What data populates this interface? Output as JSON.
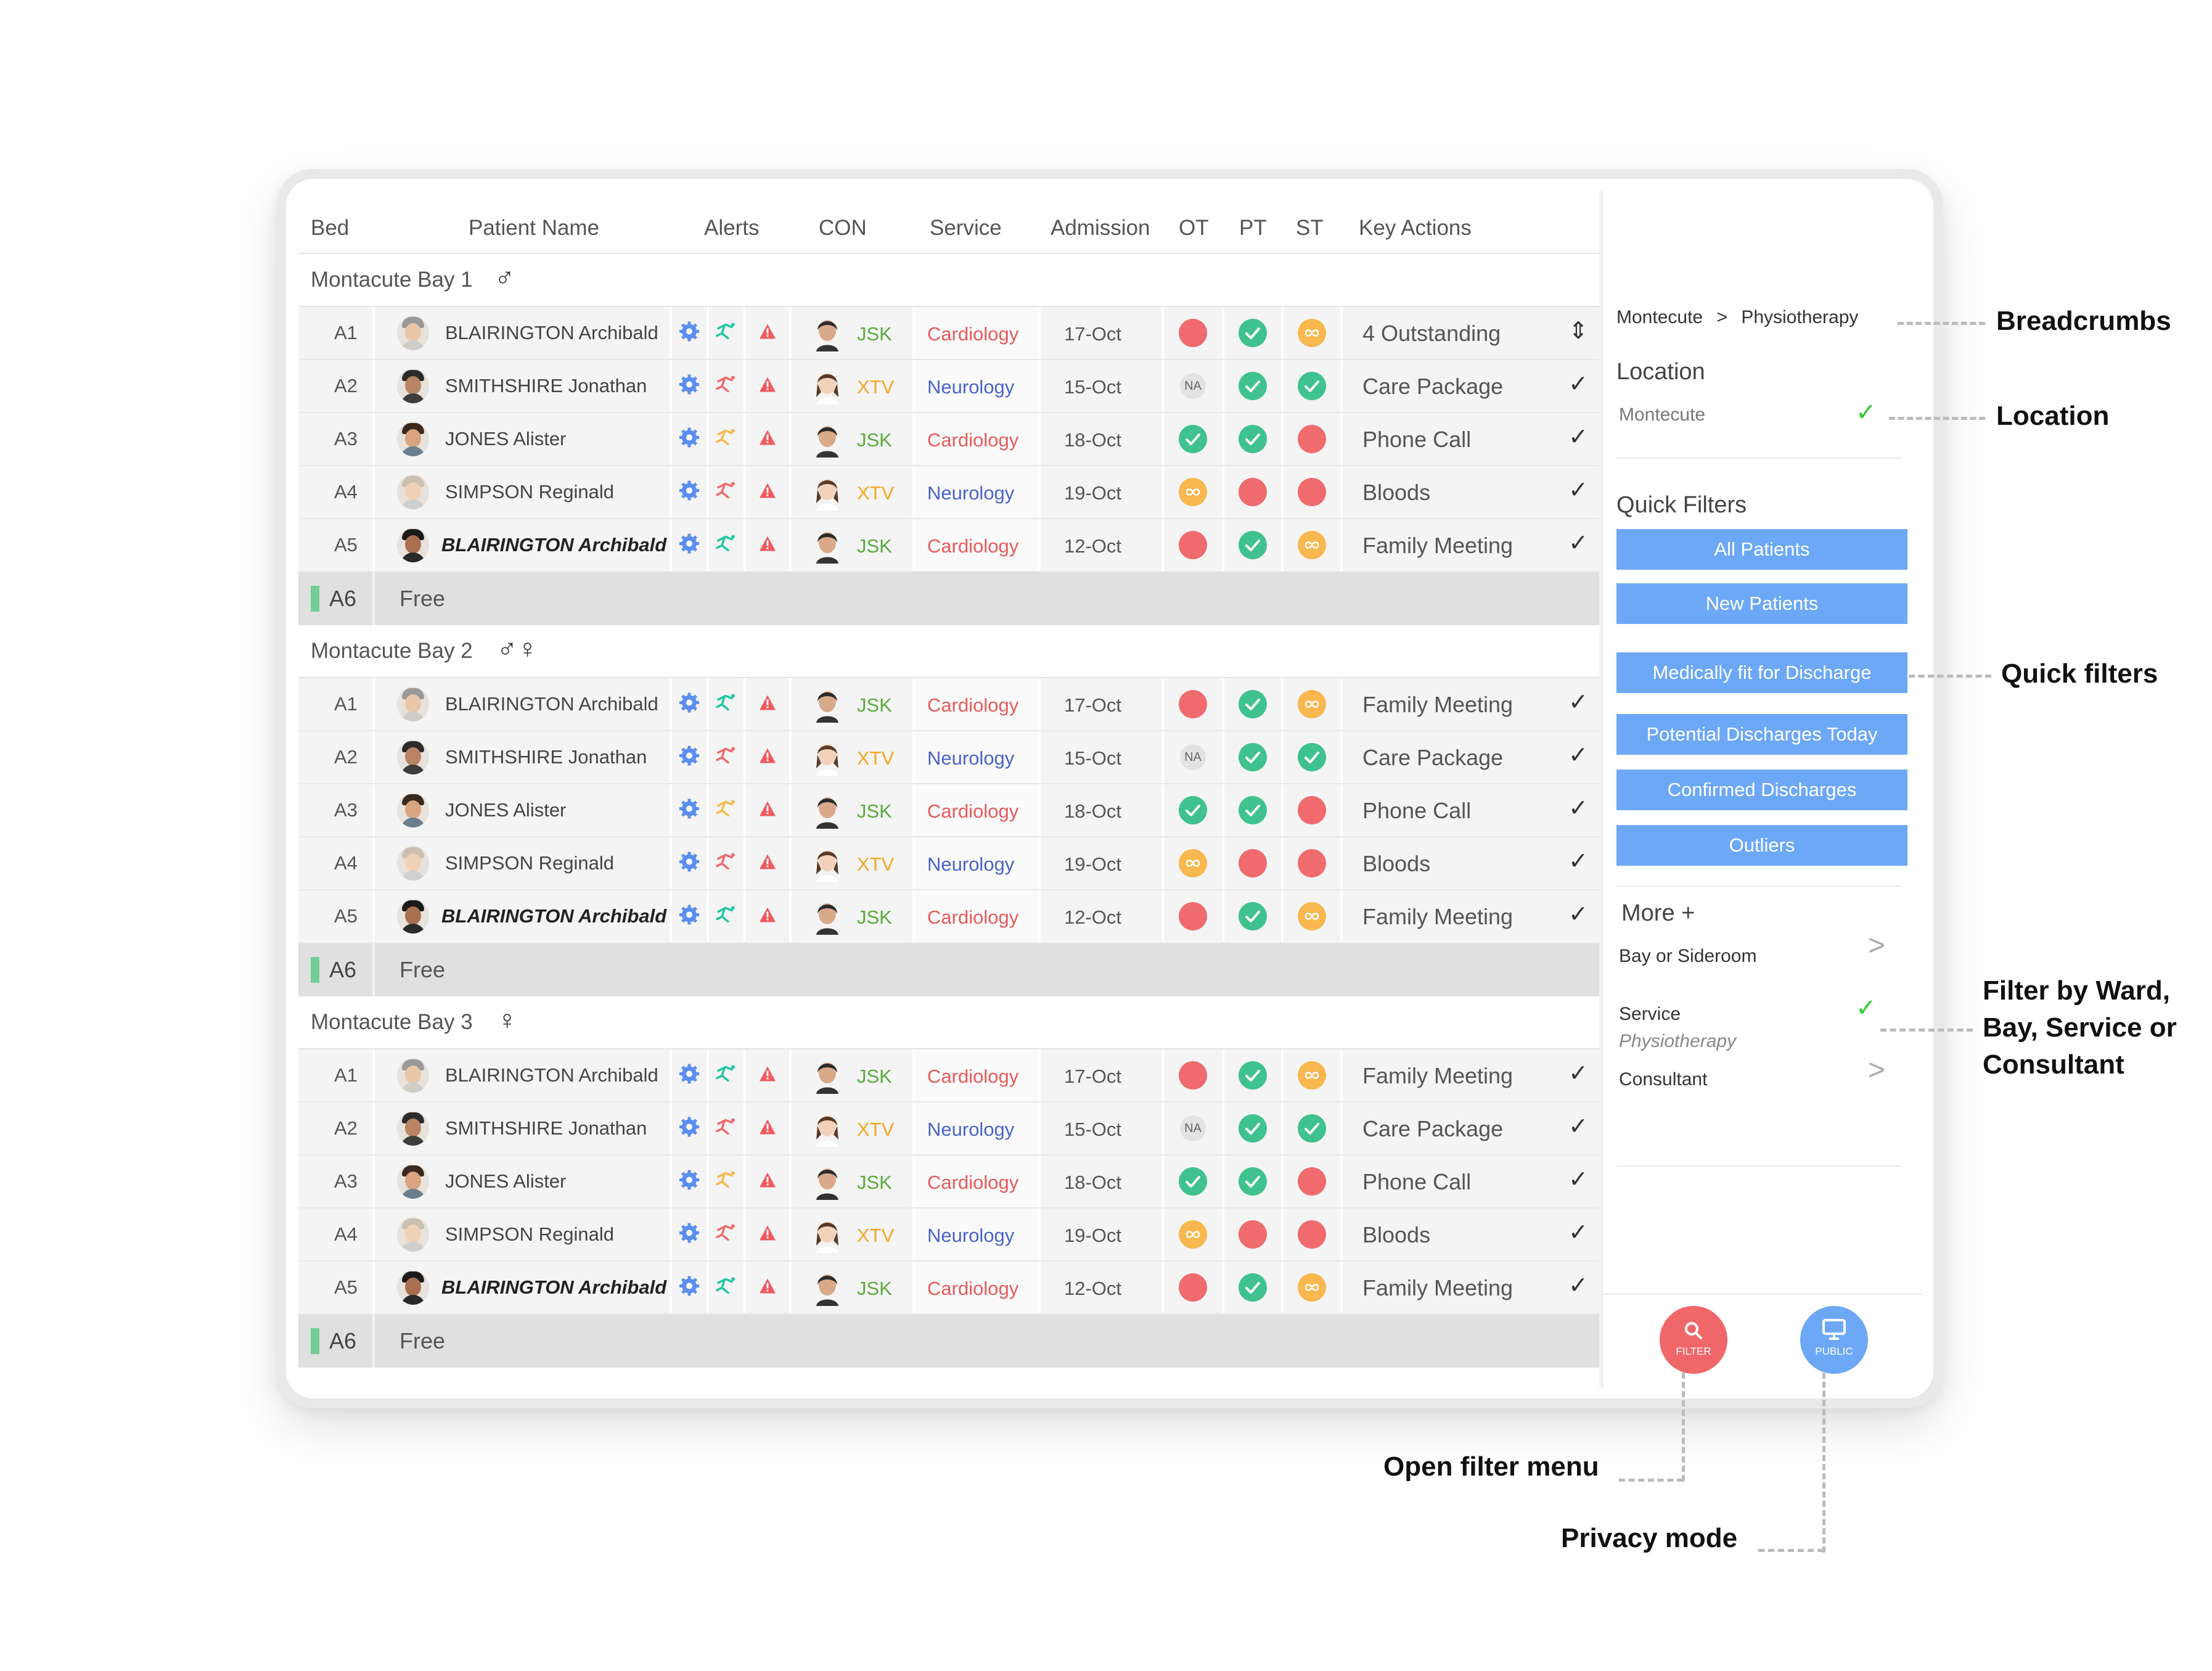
{
  "columns": [
    "Bed",
    "Patient Name",
    "Alerts",
    "CON",
    "Service",
    "Admission",
    "OT",
    "PT",
    "ST",
    "Key Actions"
  ],
  "bays": [
    {
      "name": "Montacute Bay 1",
      "sex_icon": "male-icon",
      "sex_symbol": "♂",
      "rows": [
        {
          "bed": "A1",
          "name": "BLAIRINGTON Archibald",
          "con": "JSK",
          "service": "Cardiology",
          "admission": "17-Oct",
          "ot": "red",
          "pt": "green",
          "st": "orange",
          "action": "4 Outstanding",
          "mark": "⇕"
        },
        {
          "bed": "A2",
          "name": "SMITHSHIRE Jonathan",
          "con": "XTV",
          "service": "Neurology",
          "admission": "15-Oct",
          "ot": "na",
          "pt": "green",
          "st": "green",
          "action": "Care Package",
          "mark": "✓"
        },
        {
          "bed": "A3",
          "name": "JONES Alister",
          "con": "JSK",
          "service": "Cardiology",
          "admission": "18-Oct",
          "ot": "green",
          "pt": "green",
          "st": "red",
          "action": "Phone Call",
          "mark": "✓"
        },
        {
          "bed": "A4",
          "name": "SIMPSON Reginald",
          "con": "XTV",
          "service": "Neurology",
          "admission": "19-Oct",
          "ot": "orange",
          "pt": "red",
          "st": "red",
          "action": "Bloods",
          "mark": "✓"
        },
        {
          "bed": "A5",
          "name": "BLAIRINGTON Archibald",
          "con": "JSK",
          "service": "Cardiology",
          "admission": "12-Oct",
          "ot": "red",
          "pt": "green",
          "st": "orange",
          "action": "Family Meeting",
          "mark": "✓"
        }
      ],
      "free": {
        "bed": "A6",
        "label": "Free"
      }
    },
    {
      "name": "Montacute Bay 2",
      "sex_icon": "mixed-sex-icon",
      "sex_symbol": "♂♀",
      "rows": [
        {
          "bed": "A1",
          "name": "BLAIRINGTON Archibald",
          "con": "JSK",
          "service": "Cardiology",
          "admission": "17-Oct",
          "ot": "red",
          "pt": "green",
          "st": "orange",
          "action": "Family Meeting",
          "mark": "✓"
        },
        {
          "bed": "A2",
          "name": "SMITHSHIRE Jonathan",
          "con": "XTV",
          "service": "Neurology",
          "admission": "15-Oct",
          "ot": "na",
          "pt": "green",
          "st": "green",
          "action": "Care Package",
          "mark": "✓"
        },
        {
          "bed": "A3",
          "name": "JONES Alister",
          "con": "JSK",
          "service": "Cardiology",
          "admission": "18-Oct",
          "ot": "green",
          "pt": "green",
          "st": "red",
          "action": "Phone Call",
          "mark": "✓"
        },
        {
          "bed": "A4",
          "name": "SIMPSON Reginald",
          "con": "XTV",
          "service": "Neurology",
          "admission": "19-Oct",
          "ot": "orange",
          "pt": "red",
          "st": "red",
          "action": "Bloods",
          "mark": "✓"
        },
        {
          "bed": "A5",
          "name": "BLAIRINGTON Archibald",
          "con": "JSK",
          "service": "Cardiology",
          "admission": "12-Oct",
          "ot": "red",
          "pt": "green",
          "st": "orange",
          "action": "Family Meeting",
          "mark": "✓"
        }
      ],
      "free": {
        "bed": "A6",
        "label": "Free"
      }
    },
    {
      "name": "Montacute Bay 3",
      "sex_icon": "female-icon",
      "sex_symbol": "♀",
      "rows": [
        {
          "bed": "A1",
          "name": "BLAIRINGTON Archibald",
          "con": "JSK",
          "service": "Cardiology",
          "admission": "17-Oct",
          "ot": "red",
          "pt": "green",
          "st": "orange",
          "action": "Family Meeting",
          "mark": "✓"
        },
        {
          "bed": "A2",
          "name": "SMITHSHIRE Jonathan",
          "con": "XTV",
          "service": "Neurology",
          "admission": "15-Oct",
          "ot": "na",
          "pt": "green",
          "st": "green",
          "action": "Care Package",
          "mark": "✓"
        },
        {
          "bed": "A3",
          "name": "JONES Alister",
          "con": "JSK",
          "service": "Cardiology",
          "admission": "18-Oct",
          "ot": "green",
          "pt": "green",
          "st": "red",
          "action": "Phone Call",
          "mark": "✓"
        },
        {
          "bed": "A4",
          "name": "SIMPSON Reginald",
          "con": "XTV",
          "service": "Neurology",
          "admission": "19-Oct",
          "ot": "orange",
          "pt": "red",
          "st": "red",
          "action": "Bloods",
          "mark": "✓"
        },
        {
          "bed": "A5",
          "name": "BLAIRINGTON Archibald",
          "con": "JSK",
          "service": "Cardiology",
          "admission": "12-Oct",
          "ot": "red",
          "pt": "green",
          "st": "orange",
          "action": "Family Meeting",
          "mark": "✓"
        }
      ],
      "free": {
        "bed": "A6",
        "label": "Free"
      }
    }
  ],
  "na_label": "NA",
  "sidebar": {
    "breadcrumb": {
      "first": "Montecute",
      "sep": ">",
      "second": "Physiotherapy"
    },
    "location_heading": "Location",
    "location_value": "Montecute",
    "quick_filters_heading": "Quick Filters",
    "quick_filters": [
      "All Patients",
      "New Patients",
      "Medically fit for Discharge",
      "Potential Discharges Today",
      "Confirmed Discharges",
      "Outliers"
    ],
    "more_heading": "More +",
    "bay_filter": "Bay or Sideroom",
    "service_label": "Service",
    "service_value": "Physiotherapy",
    "consultant_label": "Consultant",
    "chevron": ">",
    "tick": "✓",
    "filter_button": "FILTER",
    "public_button": "PUBLIC"
  },
  "annotations": {
    "breadcrumbs": "Breadcrumbs",
    "location": "Location",
    "quick_filters": "Quick filters",
    "filter_by_line1": "Filter by Ward,",
    "filter_by_line2": "Bay, Service or",
    "filter_by_line3": "Consultant",
    "open_filter": "Open filter menu",
    "privacy": "Privacy mode"
  },
  "colors": {
    "status_red": "#ef6b6e",
    "status_green": "#3fc28f",
    "status_orange": "#f8b84f",
    "cardiology": "#e85a5a",
    "neurology": "#4a63c8",
    "con_jsk": "#5aab3c",
    "con_xtv": "#f5a623",
    "quick_filter_bg": "#6da8f6",
    "filter_fab": "#f0676a",
    "public_fab": "#6da8f6"
  }
}
